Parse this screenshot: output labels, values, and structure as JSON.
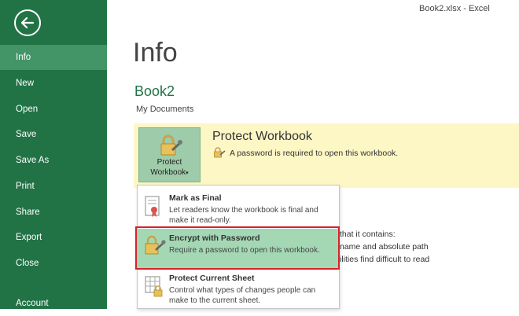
{
  "window": {
    "title": "Book2.xlsx - Excel"
  },
  "sidebar": {
    "back_label": "",
    "items": [
      {
        "label": "Info"
      },
      {
        "label": "New"
      },
      {
        "label": "Open"
      },
      {
        "label": "Save"
      },
      {
        "label": "Save As"
      },
      {
        "label": "Print"
      },
      {
        "label": "Share"
      },
      {
        "label": "Export"
      },
      {
        "label": "Close"
      },
      {
        "label": "Account"
      }
    ]
  },
  "main": {
    "title": "Info",
    "workbook_name": "Book2",
    "workbook_location": "My Documents"
  },
  "protect": {
    "button_line1": "Protect",
    "button_line2": "Workbook",
    "title": "Protect Workbook",
    "description": "A password is required to open this workbook."
  },
  "background_text": {
    "line1": "that it contains:",
    "line2": "name and absolute path",
    "line3": "ilities find difficult to read"
  },
  "menu": {
    "items": [
      {
        "title": "Mark as Final",
        "desc": "Let readers know the workbook is final and make it read-only."
      },
      {
        "title": "Encrypt with Password",
        "desc": "Require a password to open this workbook."
      },
      {
        "title": "Protect Current Sheet",
        "desc": "Control what types of changes people can make to the current sheet."
      }
    ]
  },
  "colors": {
    "sidebar": "#217346",
    "sidebar_active": "#439467",
    "accent_text": "#217346",
    "protect_panel": "#FDF6C5",
    "menu_selected": "#A4D8B4",
    "highlight_border": "#D6212A"
  }
}
